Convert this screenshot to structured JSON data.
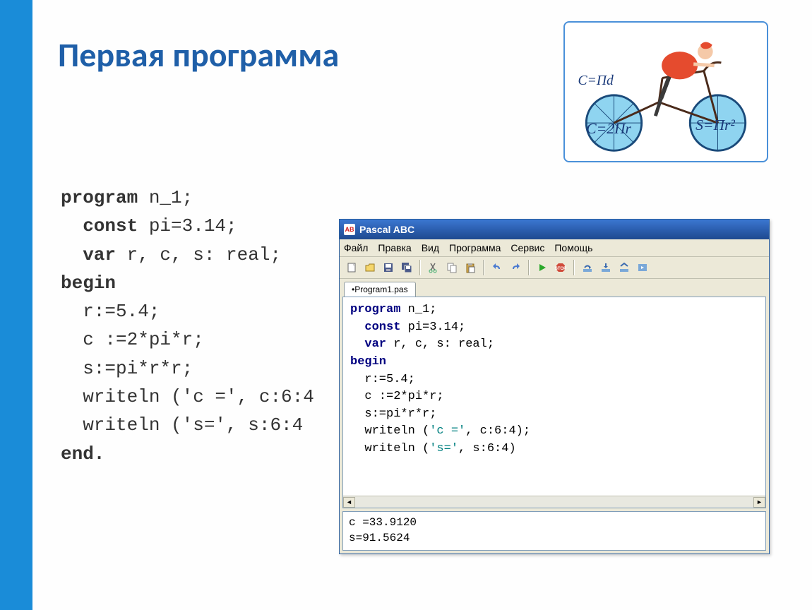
{
  "slide": {
    "title": "Первая программа",
    "formulas": {
      "c_pd": "C=Пd",
      "c_2pr": "C=2Пr",
      "s_pr2": "S=Пr²"
    }
  },
  "code": {
    "l1_kw": "program",
    "l1_rest": " n_1;",
    "l2_kw": "  const",
    "l2_rest": " pi=3.14;",
    "l3_kw": "  var",
    "l3_rest": " r, c, s: real;",
    "l4_kw": "begin",
    "l5": "  r:=5.4;",
    "l6": "  c :=2*pi*r;",
    "l7": "  s:=pi*r*r;",
    "l8": "  writeln ('c =', c:6:4",
    "l9": "  writeln ('s=', s:6:4",
    "l10_kw": "end."
  },
  "pascal": {
    "title": "Pascal ABC",
    "menu": {
      "file": "Файл",
      "edit": "Правка",
      "view": "Вид",
      "program": "Программа",
      "service": "Сервис",
      "help": "Помощь"
    },
    "tab": "•Program1.pas",
    "editor": {
      "l1a": "program",
      "l1b": " n_1;",
      "l2a": "  const",
      "l2b": " pi=3.14;",
      "l3a": "  var",
      "l3b": " r, c, s: real;",
      "l4a": "begin",
      "l5": "  r:=5.4;",
      "l6": "  c :=2*pi*r;",
      "l7": "  s:=pi*r*r;",
      "l8a": "  writeln (",
      "l8s": "'c ='",
      "l8b": ", c:6:4);",
      "l9a": "  writeln (",
      "l9s": "'s='",
      "l9b": ", s:6:4)"
    },
    "output": {
      "l1": "c =33.9120",
      "l2": "s=91.5624"
    }
  }
}
